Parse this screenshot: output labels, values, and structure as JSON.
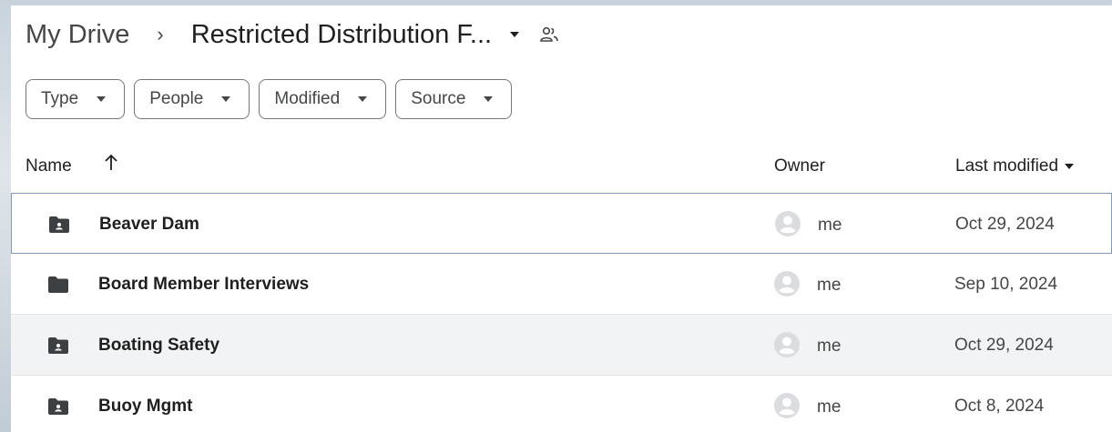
{
  "breadcrumb": {
    "root": "My Drive",
    "separator": "›",
    "current": "Restricted Distribution F..."
  },
  "icons": {
    "shared": "shared-people-icon",
    "sort": "arrow-up-icon",
    "folder": "folder-icon",
    "shared_folder": "shared-folder-icon",
    "avatar": "person-avatar-icon"
  },
  "filters": [
    {
      "label": "Type"
    },
    {
      "label": "People"
    },
    {
      "label": "Modified"
    },
    {
      "label": "Source"
    }
  ],
  "columns": {
    "name": "Name",
    "owner": "Owner",
    "last_modified": "Last modified"
  },
  "rows": [
    {
      "name": "Beaver Dam",
      "owner": "me",
      "modified": "Oct 29, 2024",
      "shared": true
    },
    {
      "name": "Board Member Interviews",
      "owner": "me",
      "modified": "Sep 10, 2024",
      "shared": false
    },
    {
      "name": "Boating Safety",
      "owner": "me",
      "modified": "Oct 29, 2024",
      "shared": true
    },
    {
      "name": "Buoy Mgmt",
      "owner": "me",
      "modified": "Oct 8, 2024",
      "shared": true
    }
  ]
}
